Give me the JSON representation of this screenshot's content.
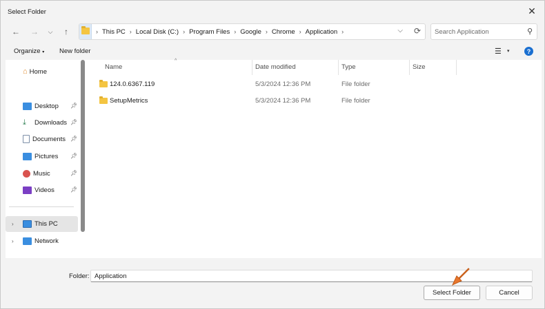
{
  "window": {
    "title": "Select Folder"
  },
  "address_bar": {
    "crumbs": [
      "This PC",
      "Local Disk (C:)",
      "Program Files",
      "Google",
      "Chrome",
      "Application"
    ]
  },
  "search": {
    "placeholder": "Search Application"
  },
  "toolbar": {
    "organize_label": "Organize",
    "new_folder_label": "New folder"
  },
  "nav": {
    "home": "Home",
    "quick_access": [
      {
        "label": "Desktop",
        "icon": "desktop-icon",
        "color": "#3a8ee0"
      },
      {
        "label": "Downloads",
        "icon": "download-icon",
        "color": "#2a7d4f"
      },
      {
        "label": "Documents",
        "icon": "document-icon",
        "color": "#7d8fa8"
      },
      {
        "label": "Pictures",
        "icon": "pictures-icon",
        "color": "#3a8ee0"
      },
      {
        "label": "Music",
        "icon": "music-icon",
        "color": "#d9534f"
      },
      {
        "label": "Videos",
        "icon": "videos-icon",
        "color": "#7b3fc4"
      }
    ],
    "this_pc": "This PC",
    "network": "Network"
  },
  "columns": {
    "name": "Name",
    "date_modified": "Date modified",
    "type": "Type",
    "size": "Size"
  },
  "files": [
    {
      "name": "124.0.6367.119",
      "date": "5/3/2024 12:36 PM",
      "type": "File folder"
    },
    {
      "name": "SetupMetrics",
      "date": "5/3/2024 12:36 PM",
      "type": "File folder"
    }
  ],
  "footer": {
    "folder_label": "Folder:",
    "folder_value": "Application",
    "select_label": "Select Folder",
    "cancel_label": "Cancel"
  },
  "colors": {
    "accent": "#1a6fd0",
    "annotation_arrow": "#e8772e",
    "folder": "#f4c542"
  }
}
